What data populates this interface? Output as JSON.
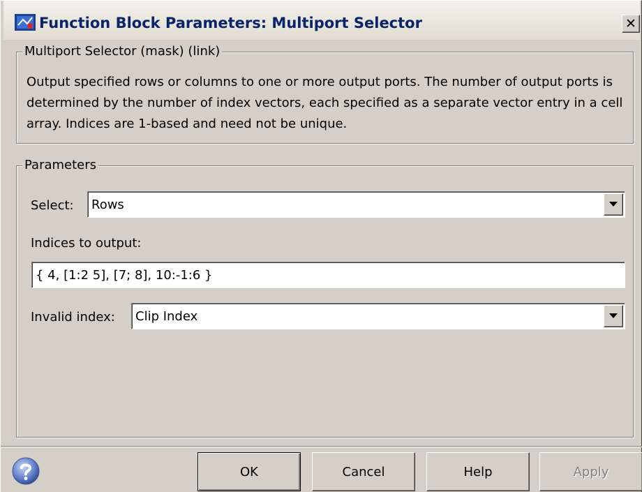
{
  "window": {
    "title": "Function Block Parameters: Multiport Selector",
    "close_glyph": "✕"
  },
  "description_group": {
    "legend": "Multiport Selector (mask) (link)",
    "text": "Output specified rows or columns to one or more output ports.  The number of output ports is determined by the number of index vectors, each specified as a separate vector entry in a cell array.  Indices are 1-based and need not be unique."
  },
  "parameters": {
    "legend": "Parameters",
    "select": {
      "label": "Select:",
      "value": "Rows"
    },
    "indices": {
      "label": "Indices to output:",
      "value": "{ 4, [1:2 5], [7; 8], 10:-1:6 }"
    },
    "invalid_index": {
      "label": "Invalid index:",
      "value": "Clip Index"
    }
  },
  "buttons": {
    "ok": "OK",
    "cancel": "Cancel",
    "help": "Help",
    "apply": "Apply"
  },
  "icons": {
    "app": "simulink-block-icon",
    "help": "question-mark-icon"
  },
  "colors": {
    "face": "#d4d0c8",
    "title_text": "#0a246a",
    "disabled_text": "#808080"
  }
}
